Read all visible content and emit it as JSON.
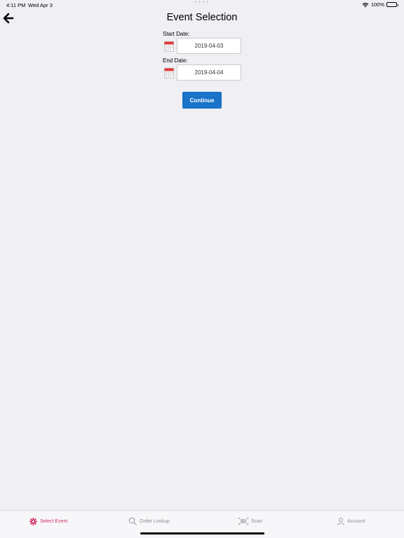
{
  "status_bar": {
    "time": "4:11 PM",
    "date": "Wed Apr 3",
    "dots": "• • • •",
    "battery": "100%"
  },
  "header": {
    "title": "Event Selection",
    "back_icon": "arrow-left-icon"
  },
  "form": {
    "start_label": "Start Date:",
    "start_value": "2019-04-03",
    "end_label": "End Date:",
    "end_value": "2019-04-04",
    "calendar_icon": "calendar-icon",
    "continue_label": "Continue"
  },
  "tab_bar": {
    "tabs": [
      {
        "label": "Select Event",
        "icon": "gear-icon",
        "active": true
      },
      {
        "label": "Order Lookup",
        "icon": "search-icon",
        "active": false
      },
      {
        "label": "Scan",
        "icon": "barcode-icon",
        "active": false
      },
      {
        "label": "Account",
        "icon": "person-icon",
        "active": false
      }
    ]
  },
  "colors": {
    "background": "#efeff4",
    "accent": "#1a73c8",
    "active_tab": "#d8306a",
    "inactive_tab": "#8e8e93"
  }
}
